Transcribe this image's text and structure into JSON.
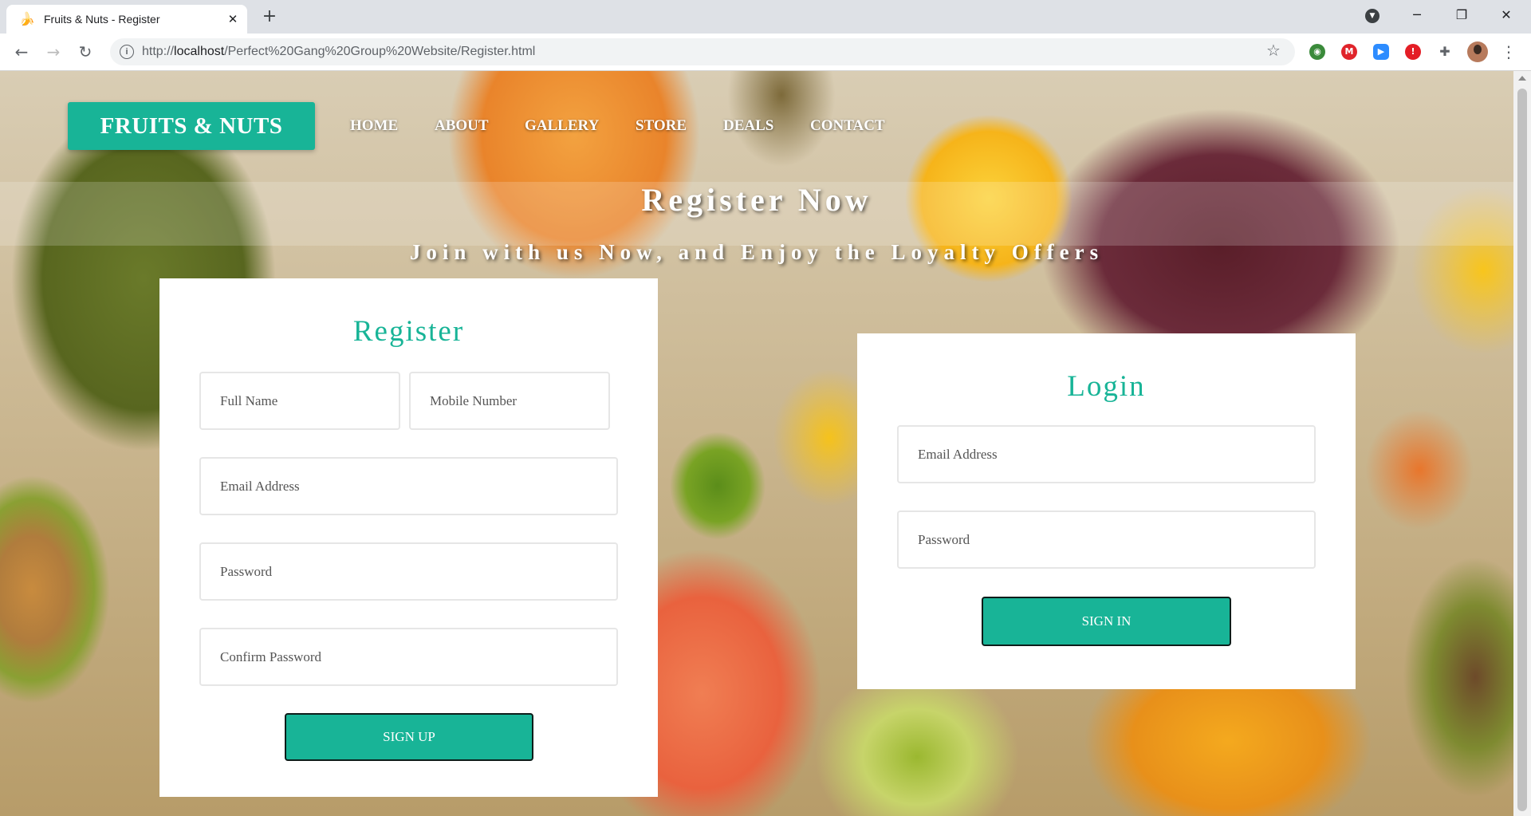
{
  "browser": {
    "tab_title": "Fruits & Nuts - Register",
    "tab_close": "✕",
    "new_tab": "+",
    "url_prefix": "http://",
    "url_host": "localhost",
    "url_path": "/Perfect%20Gang%20Group%20Website/Register.html",
    "window": {
      "minimize": "─",
      "restore": "❐",
      "close": "✕"
    }
  },
  "site": {
    "brand": "FRUITS & NUTS",
    "nav": [
      "HOME",
      "ABOUT",
      "GALLERY",
      "STORE",
      "DEALS",
      "CONTACT"
    ],
    "hero_title": "Register Now",
    "hero_subtitle": "Join with us Now, and Enjoy the Loyalty Offers"
  },
  "register": {
    "title": "Register",
    "full_name_placeholder": "Full Name",
    "mobile_placeholder": "Mobile Number",
    "email_placeholder": "Email Address",
    "password_placeholder": "Password",
    "confirm_password_placeholder": "Confirm Password",
    "submit_label": "SIGN UP"
  },
  "login": {
    "title": "Login",
    "email_placeholder": "Email Address",
    "password_placeholder": "Password",
    "submit_label": "SIGN IN"
  },
  "colors": {
    "accent": "#18b497",
    "chrome_bg": "#dee1e6"
  },
  "icons": {
    "extensions": [
      "globe-extension-icon",
      "m-extension-icon",
      "video-extension-icon",
      "red-extension-icon",
      "puzzle-icon"
    ]
  }
}
